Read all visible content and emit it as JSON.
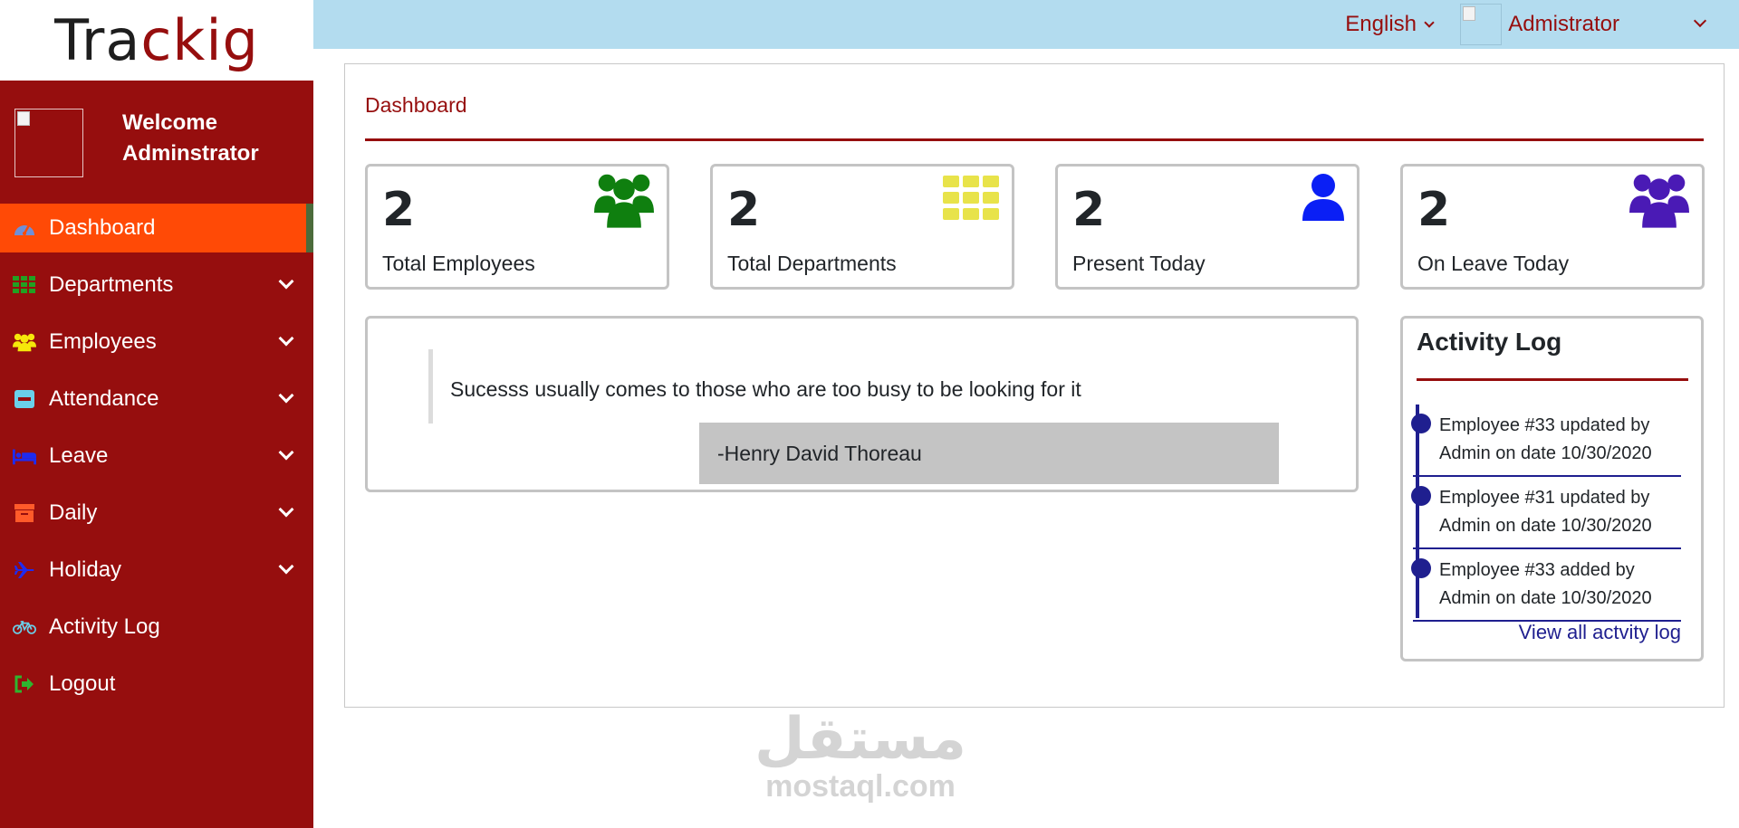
{
  "brand": {
    "part1": "Tra",
    "part2": "ckig"
  },
  "colors": {
    "brand": "#960e0e",
    "topbar": "#b3dcef",
    "active_nav": "#ff4a06",
    "timeline": "#1f1f8f"
  },
  "sidebar": {
    "welcome_line1": "Welcome",
    "welcome_line2": "Adminstrator",
    "items": [
      {
        "label": "Dashboard",
        "icon": "dashboard-gauge-icon",
        "active": true
      },
      {
        "label": "Departments",
        "icon": "grid-icon",
        "dropdown": true
      },
      {
        "label": "Employees",
        "icon": "users-icon",
        "dropdown": true
      },
      {
        "label": "Attendance",
        "icon": "minus-square-icon",
        "dropdown": true
      },
      {
        "label": "Leave",
        "icon": "bed-icon",
        "dropdown": true
      },
      {
        "label": "Daily",
        "icon": "archive-box-icon",
        "dropdown": true
      },
      {
        "label": "Holiday",
        "icon": "plane-icon",
        "dropdown": true
      },
      {
        "label": "Activity Log",
        "icon": "bicycle-icon"
      },
      {
        "label": "Logout",
        "icon": "sign-out-icon"
      }
    ]
  },
  "topbar": {
    "language": "English",
    "user": "Admistrator"
  },
  "main": {
    "title": "Dashboard",
    "stats": [
      {
        "value": "2",
        "label": "Total Employees",
        "icon": "users-icon",
        "color": "#0f7f0f"
      },
      {
        "value": "2",
        "label": "Total Departments",
        "icon": "grid-icon",
        "color": "#e8e34a"
      },
      {
        "value": "2",
        "label": "Present Today",
        "icon": "user-icon",
        "color": "#0a1ff5"
      },
      {
        "value": "2",
        "label": "On Leave Today",
        "icon": "users-icon",
        "color": "#4a1ab5"
      }
    ],
    "quote": {
      "text": "Sucesss usually comes to those who are too busy to be looking for it",
      "author": "-Henry David Thoreau"
    },
    "activity": {
      "title": "Activity Log",
      "entries": [
        {
          "line1": "Employee #33 updated by",
          "line2": "Admin on date 10/30/2020"
        },
        {
          "line1": "Employee #31 updated by",
          "line2": "Admin on date 10/30/2020"
        },
        {
          "line1": "Employee #33 added by",
          "line2": "Admin on date 10/30/2020"
        }
      ],
      "view_all": "View all actvity log"
    }
  },
  "watermark": {
    "arabic": "مستقل",
    "latin": "mostaql.com"
  }
}
